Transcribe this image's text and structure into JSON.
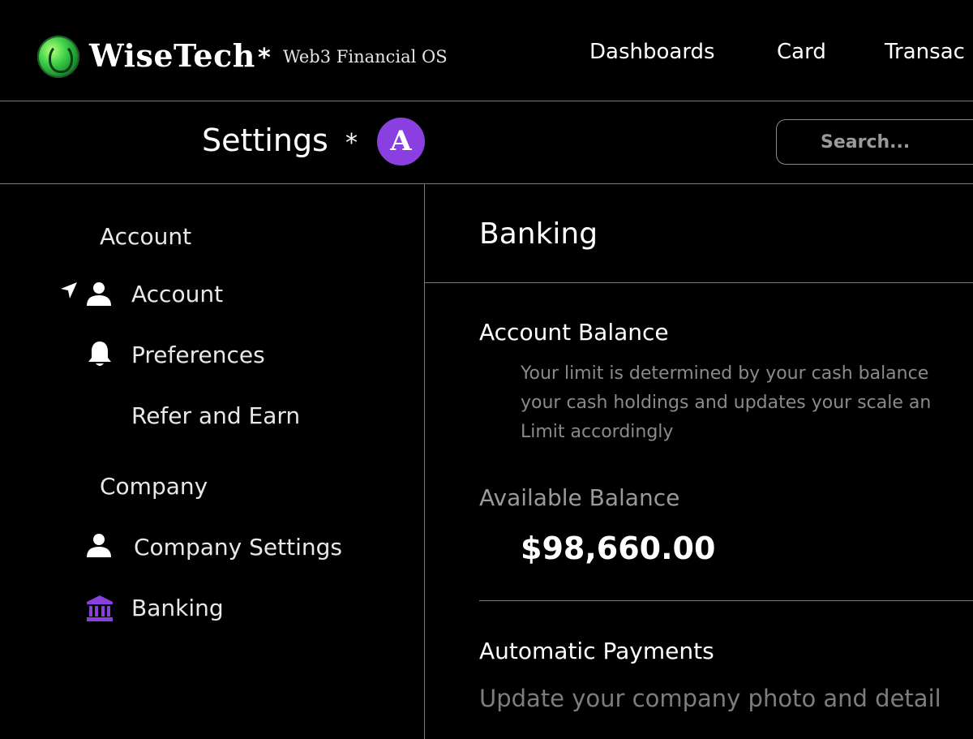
{
  "header": {
    "brand": "WiseTech",
    "separator": "*",
    "tagline": "Web3 Financial OS",
    "nav": [
      "Dashboards",
      "Card",
      "Transac"
    ]
  },
  "subheader": {
    "title": "Settings",
    "separator": "*",
    "avatar_initial": "A",
    "avatar_color": "#8a3fe0",
    "search_placeholder": "Search..."
  },
  "sidebar": {
    "sections": [
      {
        "label": "Account",
        "items": [
          {
            "label": "Account",
            "icon": "user-icon",
            "marker": "navigation-arrow-icon"
          },
          {
            "label": "Preferences",
            "icon": "bell-icon"
          },
          {
            "label": "Refer and Earn",
            "icon": ""
          }
        ]
      },
      {
        "label": "Company",
        "items": [
          {
            "label": "Company Settings",
            "icon": "user-icon"
          },
          {
            "label": "Banking",
            "icon": "bank-icon",
            "active": true,
            "icon_color": "#8a3fe0"
          }
        ]
      }
    ]
  },
  "main": {
    "title": "Banking",
    "account_balance": {
      "title": "Account Balance",
      "description_lines": [
        "Your limit is determined by your cash balance",
        "your cash holdings and updates your scale an",
        "Limit accordingly"
      ]
    },
    "available_balance": {
      "label": "Available Balance",
      "value": "$98,660.00"
    },
    "automatic_payments": {
      "title": "Automatic Payments",
      "description": "Update your company photo and detail"
    }
  }
}
